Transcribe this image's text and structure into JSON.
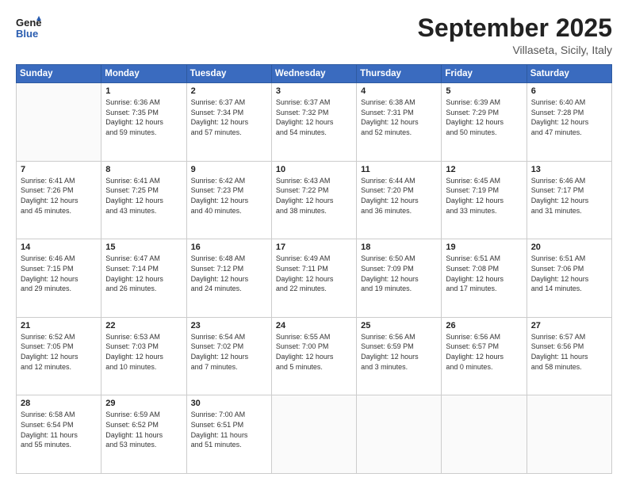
{
  "header": {
    "logo_line1": "General",
    "logo_line2": "Blue",
    "month": "September 2025",
    "location": "Villaseta, Sicily, Italy"
  },
  "weekdays": [
    "Sunday",
    "Monday",
    "Tuesday",
    "Wednesday",
    "Thursday",
    "Friday",
    "Saturday"
  ],
  "weeks": [
    [
      {
        "day": "",
        "info": ""
      },
      {
        "day": "1",
        "info": "Sunrise: 6:36 AM\nSunset: 7:35 PM\nDaylight: 12 hours\nand 59 minutes."
      },
      {
        "day": "2",
        "info": "Sunrise: 6:37 AM\nSunset: 7:34 PM\nDaylight: 12 hours\nand 57 minutes."
      },
      {
        "day": "3",
        "info": "Sunrise: 6:37 AM\nSunset: 7:32 PM\nDaylight: 12 hours\nand 54 minutes."
      },
      {
        "day": "4",
        "info": "Sunrise: 6:38 AM\nSunset: 7:31 PM\nDaylight: 12 hours\nand 52 minutes."
      },
      {
        "day": "5",
        "info": "Sunrise: 6:39 AM\nSunset: 7:29 PM\nDaylight: 12 hours\nand 50 minutes."
      },
      {
        "day": "6",
        "info": "Sunrise: 6:40 AM\nSunset: 7:28 PM\nDaylight: 12 hours\nand 47 minutes."
      }
    ],
    [
      {
        "day": "7",
        "info": "Sunrise: 6:41 AM\nSunset: 7:26 PM\nDaylight: 12 hours\nand 45 minutes."
      },
      {
        "day": "8",
        "info": "Sunrise: 6:41 AM\nSunset: 7:25 PM\nDaylight: 12 hours\nand 43 minutes."
      },
      {
        "day": "9",
        "info": "Sunrise: 6:42 AM\nSunset: 7:23 PM\nDaylight: 12 hours\nand 40 minutes."
      },
      {
        "day": "10",
        "info": "Sunrise: 6:43 AM\nSunset: 7:22 PM\nDaylight: 12 hours\nand 38 minutes."
      },
      {
        "day": "11",
        "info": "Sunrise: 6:44 AM\nSunset: 7:20 PM\nDaylight: 12 hours\nand 36 minutes."
      },
      {
        "day": "12",
        "info": "Sunrise: 6:45 AM\nSunset: 7:19 PM\nDaylight: 12 hours\nand 33 minutes."
      },
      {
        "day": "13",
        "info": "Sunrise: 6:46 AM\nSunset: 7:17 PM\nDaylight: 12 hours\nand 31 minutes."
      }
    ],
    [
      {
        "day": "14",
        "info": "Sunrise: 6:46 AM\nSunset: 7:15 PM\nDaylight: 12 hours\nand 29 minutes."
      },
      {
        "day": "15",
        "info": "Sunrise: 6:47 AM\nSunset: 7:14 PM\nDaylight: 12 hours\nand 26 minutes."
      },
      {
        "day": "16",
        "info": "Sunrise: 6:48 AM\nSunset: 7:12 PM\nDaylight: 12 hours\nand 24 minutes."
      },
      {
        "day": "17",
        "info": "Sunrise: 6:49 AM\nSunset: 7:11 PM\nDaylight: 12 hours\nand 22 minutes."
      },
      {
        "day": "18",
        "info": "Sunrise: 6:50 AM\nSunset: 7:09 PM\nDaylight: 12 hours\nand 19 minutes."
      },
      {
        "day": "19",
        "info": "Sunrise: 6:51 AM\nSunset: 7:08 PM\nDaylight: 12 hours\nand 17 minutes."
      },
      {
        "day": "20",
        "info": "Sunrise: 6:51 AM\nSunset: 7:06 PM\nDaylight: 12 hours\nand 14 minutes."
      }
    ],
    [
      {
        "day": "21",
        "info": "Sunrise: 6:52 AM\nSunset: 7:05 PM\nDaylight: 12 hours\nand 12 minutes."
      },
      {
        "day": "22",
        "info": "Sunrise: 6:53 AM\nSunset: 7:03 PM\nDaylight: 12 hours\nand 10 minutes."
      },
      {
        "day": "23",
        "info": "Sunrise: 6:54 AM\nSunset: 7:02 PM\nDaylight: 12 hours\nand 7 minutes."
      },
      {
        "day": "24",
        "info": "Sunrise: 6:55 AM\nSunset: 7:00 PM\nDaylight: 12 hours\nand 5 minutes."
      },
      {
        "day": "25",
        "info": "Sunrise: 6:56 AM\nSunset: 6:59 PM\nDaylight: 12 hours\nand 3 minutes."
      },
      {
        "day": "26",
        "info": "Sunrise: 6:56 AM\nSunset: 6:57 PM\nDaylight: 12 hours\nand 0 minutes."
      },
      {
        "day": "27",
        "info": "Sunrise: 6:57 AM\nSunset: 6:56 PM\nDaylight: 11 hours\nand 58 minutes."
      }
    ],
    [
      {
        "day": "28",
        "info": "Sunrise: 6:58 AM\nSunset: 6:54 PM\nDaylight: 11 hours\nand 55 minutes."
      },
      {
        "day": "29",
        "info": "Sunrise: 6:59 AM\nSunset: 6:52 PM\nDaylight: 11 hours\nand 53 minutes."
      },
      {
        "day": "30",
        "info": "Sunrise: 7:00 AM\nSunset: 6:51 PM\nDaylight: 11 hours\nand 51 minutes."
      },
      {
        "day": "",
        "info": ""
      },
      {
        "day": "",
        "info": ""
      },
      {
        "day": "",
        "info": ""
      },
      {
        "day": "",
        "info": ""
      }
    ]
  ]
}
